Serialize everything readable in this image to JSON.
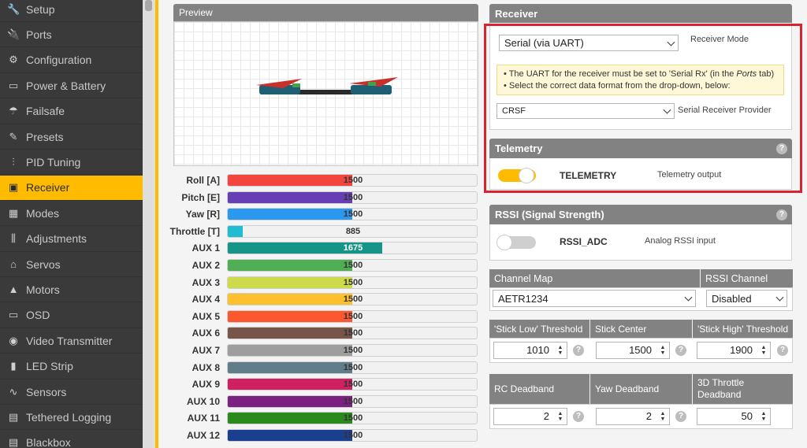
{
  "sidebar": {
    "items": [
      {
        "label": "Setup",
        "icon": "wrench-icon",
        "glyph": "🔧",
        "active": false
      },
      {
        "label": "Ports",
        "icon": "plug-icon",
        "glyph": "🔌",
        "active": false
      },
      {
        "label": "Configuration",
        "icon": "gear-icon",
        "glyph": "⚙",
        "active": false
      },
      {
        "label": "Power & Battery",
        "icon": "battery-icon",
        "glyph": "▭",
        "active": false
      },
      {
        "label": "Failsafe",
        "icon": "parachute-icon",
        "glyph": "☂",
        "active": false
      },
      {
        "label": "Presets",
        "icon": "wand-icon",
        "glyph": "✎",
        "active": false
      },
      {
        "label": "PID Tuning",
        "icon": "sliders-icon",
        "glyph": "⫶",
        "active": false
      },
      {
        "label": "Receiver",
        "icon": "receiver-icon",
        "glyph": "▣",
        "active": true
      },
      {
        "label": "Modes",
        "icon": "modes-icon",
        "glyph": "▦",
        "active": false
      },
      {
        "label": "Adjustments",
        "icon": "adjust-icon",
        "glyph": "⫼",
        "active": false
      },
      {
        "label": "Servos",
        "icon": "servo-icon",
        "glyph": "⌂",
        "active": false
      },
      {
        "label": "Motors",
        "icon": "motor-icon",
        "glyph": "▲",
        "active": false
      },
      {
        "label": "OSD",
        "icon": "osd-icon",
        "glyph": "▭",
        "active": false
      },
      {
        "label": "Video Transmitter",
        "icon": "antenna-icon",
        "glyph": "◉",
        "active": false
      },
      {
        "label": "LED Strip",
        "icon": "led-icon",
        "glyph": "▮",
        "active": false
      },
      {
        "label": "Sensors",
        "icon": "sensor-icon",
        "glyph": "∿",
        "active": false
      },
      {
        "label": "Tethered Logging",
        "icon": "log-icon",
        "glyph": "▤",
        "active": false
      },
      {
        "label": "Blackbox",
        "icon": "blackbox-icon",
        "glyph": "▤",
        "active": false
      }
    ]
  },
  "preview": {
    "title": "Preview"
  },
  "channels": [
    {
      "label": "Roll [A]",
      "value": "1500",
      "fill": 0.5,
      "color": "#f1453d"
    },
    {
      "label": "Pitch [E]",
      "value": "1500",
      "fill": 0.5,
      "color": "#673fb4"
    },
    {
      "label": "Yaw [R]",
      "value": "1500",
      "fill": 0.5,
      "color": "#2b98f0"
    },
    {
      "label": "Throttle [T]",
      "value": "885",
      "fill": 0.06,
      "color": "#1fbcd2"
    },
    {
      "label": "AUX 1",
      "value": "1675",
      "fill": 0.62,
      "color": "#159588"
    },
    {
      "label": "AUX 2",
      "value": "1500",
      "fill": 0.5,
      "color": "#50ae55"
    },
    {
      "label": "AUX 3",
      "value": "1500",
      "fill": 0.5,
      "color": "#cdda49"
    },
    {
      "label": "AUX 4",
      "value": "1500",
      "fill": 0.5,
      "color": "#fdc02f"
    },
    {
      "label": "AUX 5",
      "value": "1500",
      "fill": 0.5,
      "color": "#fc5830"
    },
    {
      "label": "AUX 6",
      "value": "1500",
      "fill": 0.5,
      "color": "#785549"
    },
    {
      "label": "AUX 7",
      "value": "1500",
      "fill": 0.5,
      "color": "#9e9e9e"
    },
    {
      "label": "AUX 8",
      "value": "1500",
      "fill": 0.5,
      "color": "#617d8a"
    },
    {
      "label": "AUX 9",
      "value": "1500",
      "fill": 0.5,
      "color": "#cf2061"
    },
    {
      "label": "AUX 10",
      "value": "1500",
      "fill": 0.5,
      "color": "#7b2181"
    },
    {
      "label": "AUX 11",
      "value": "1500",
      "fill": 0.5,
      "color": "#2b8a1c"
    },
    {
      "label": "AUX 12",
      "value": "1500",
      "fill": 0.5,
      "color": "#1b3f8f"
    }
  ],
  "receiver": {
    "title": "Receiver",
    "mode_value": "Serial (via UART)",
    "mode_label": "Receiver Mode",
    "note_line1_a": "• The UART for the receiver must be set to 'Serial Rx' (in the ",
    "note_line1_em": "Ports",
    "note_line1_b": " tab)",
    "note_line2": "• Select the correct data format from the drop-down, below:",
    "provider_value": "CRSF",
    "provider_label": "Serial Receiver Provider"
  },
  "telemetry": {
    "title": "Telemetry",
    "toggle_label": "TELEMETRY",
    "description": "Telemetry output",
    "enabled": true,
    "on_color": "#ffbb00"
  },
  "rssi": {
    "title": "RSSI (Signal Strength)",
    "toggle_label": "RSSI_ADC",
    "description": "Analog RSSI input",
    "enabled": false
  },
  "channel_map": {
    "header": "Channel Map",
    "value": "AETR1234",
    "rssi_header": "RSSI Channel",
    "rssi_value": "Disabled"
  },
  "thresholds": {
    "low_header": "'Stick Low' Threshold",
    "low_value": "1010",
    "center_header": "Stick Center",
    "center_value": "1500",
    "high_header": "'Stick High' Threshold",
    "high_value": "1900"
  },
  "deadband": {
    "rc_header": "RC Deadband",
    "rc_value": "2",
    "yaw_header": "Yaw Deadband",
    "yaw_value": "2",
    "throttle_header": "3D Throttle Deadband",
    "throttle_value": "50"
  },
  "help_glyph": "?"
}
